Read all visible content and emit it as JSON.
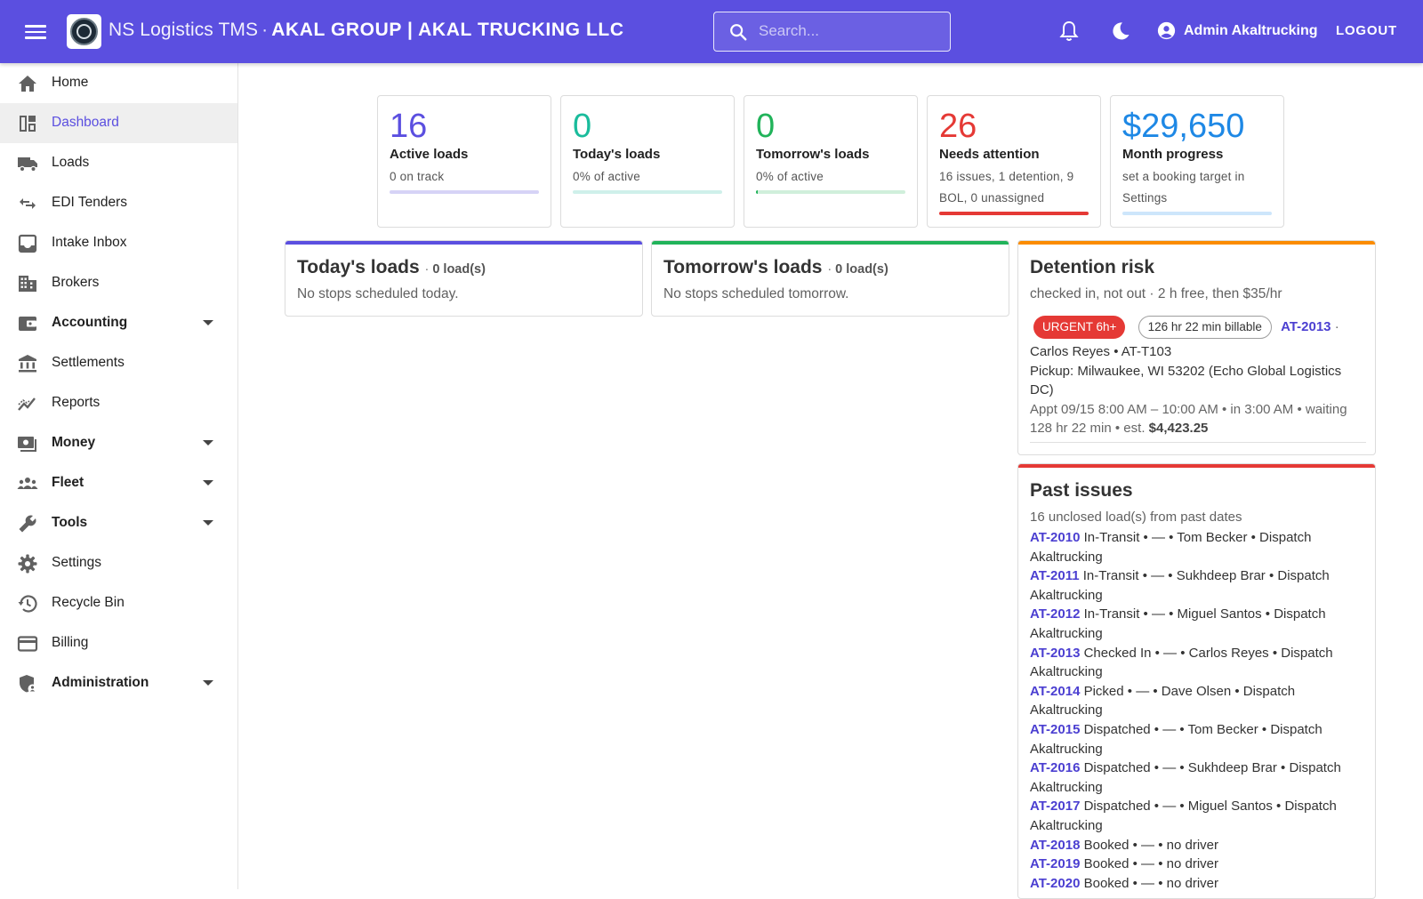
{
  "header": {
    "app_name": "NS Logistics TMS",
    "separator": "·",
    "company": "AKAL GROUP | AKAL TRUCKING LLC",
    "search_placeholder": "Search...",
    "user_name": "Admin Akaltrucking",
    "logout_label": "LOGOUT",
    "brand_color": "#5b4fe0"
  },
  "sidebar": {
    "items": [
      {
        "label": "Home",
        "icon": "home-icon"
      },
      {
        "label": "Dashboard",
        "icon": "dashboard-icon",
        "active": true
      },
      {
        "label": "Loads",
        "icon": "truck-icon"
      },
      {
        "label": "EDI Tenders",
        "icon": "swap-arrows-icon"
      },
      {
        "label": "Intake Inbox",
        "icon": "inbox-icon"
      },
      {
        "label": "Brokers",
        "icon": "building-icon"
      },
      {
        "label": "Accounting",
        "icon": "wallet-icon",
        "expandable": true
      },
      {
        "label": "Settlements",
        "icon": "bank-icon"
      },
      {
        "label": "Reports",
        "icon": "chart-line-icon"
      },
      {
        "label": "Money",
        "icon": "cash-icon",
        "expandable": true
      },
      {
        "label": "Fleet",
        "icon": "people-icon",
        "expandable": true
      },
      {
        "label": "Tools",
        "icon": "wrench-icon",
        "expandable": true
      },
      {
        "label": "Settings",
        "icon": "gear-icon"
      },
      {
        "label": "Recycle Bin",
        "icon": "history-icon"
      },
      {
        "label": "Billing",
        "icon": "credit-card-icon"
      },
      {
        "label": "Administration",
        "icon": "shield-person-icon",
        "expandable": true
      }
    ]
  },
  "stats": [
    {
      "value": "16",
      "label": "Active loads",
      "sub": "0 on track",
      "color": "#5b4fe0",
      "bar_color": "#d6d3f6",
      "progress": 0
    },
    {
      "value": "0",
      "label": "Today's loads",
      "sub": "0% of active",
      "color": "#1abc9c",
      "bar_color": "#cff0ea",
      "progress": 0
    },
    {
      "value": "0",
      "label": "Tomorrow's loads",
      "sub": "0% of active",
      "color": "#21b35a",
      "bar_color": "#d0efdb",
      "progress": 0
    },
    {
      "value": "26",
      "label": "Needs attention",
      "sub": "16 issues, 1 detention, 9 BOL, 0 unassigned",
      "color": "#e53935",
      "bar_color": "#e53935",
      "progress": 1
    },
    {
      "value": "$29,650",
      "label": "Month progress",
      "sub": "set a booking target in Settings",
      "color": "#1e88e5",
      "bar_color": "#cde6fb",
      "progress": 0
    }
  ],
  "today_panel": {
    "title": "Today's loads",
    "separator": "·",
    "count": "0 load(s)",
    "empty": "No stops scheduled today.",
    "accent": "#5b4fe0"
  },
  "tomorrow_panel": {
    "title": "Tomorrow's loads",
    "separator": "·",
    "count": "0 load(s)",
    "empty": "No stops scheduled tomorrow.",
    "accent": "#21b35a"
  },
  "detention_panel": {
    "title": "Detention risk",
    "subtitle": "checked in, not out · 2 h free, then $35/hr",
    "accent": "#fb8c00",
    "urgent_chip": "URGENT 6h+",
    "billable_chip": "126 hr 22 min billable",
    "load_id": "AT-2013",
    "load_suffix": "·",
    "driver_line": "Carlos Reyes • AT-T103",
    "pickup_line": "Pickup: Milwaukee, WI 53202 (Echo Global Logistics DC)",
    "appt_line": "Appt 09/15 8:00 AM – 10:00 AM • in 3:00 AM • waiting 128 hr 22 min • est.",
    "estimate": "$4,423.25"
  },
  "past_issues_panel": {
    "title": "Past issues",
    "subtitle": "16 unclosed load(s) from past dates",
    "accent": "#e53935",
    "rows": [
      {
        "id": "AT-2010",
        "text": "In-Transit • — • Tom Becker • Dispatch Akaltrucking"
      },
      {
        "id": "AT-2011",
        "text": "In-Transit • — • Sukhdeep Brar • Dispatch Akaltrucking"
      },
      {
        "id": "AT-2012",
        "text": "In-Transit • — • Miguel Santos • Dispatch Akaltrucking"
      },
      {
        "id": "AT-2013",
        "text": "Checked In • — • Carlos Reyes • Dispatch Akaltrucking"
      },
      {
        "id": "AT-2014",
        "text": "Picked • — • Dave Olsen • Dispatch Akaltrucking"
      },
      {
        "id": "AT-2015",
        "text": "Dispatched • — • Tom Becker • Dispatch Akaltrucking"
      },
      {
        "id": "AT-2016",
        "text": "Dispatched • — • Sukhdeep Brar • Dispatch Akaltrucking"
      },
      {
        "id": "AT-2017",
        "text": "Dispatched • — • Miguel Santos • Dispatch Akaltrucking"
      },
      {
        "id": "AT-2018",
        "text": "Booked • — • no driver"
      },
      {
        "id": "AT-2019",
        "text": "Booked • — • no driver"
      },
      {
        "id": "AT-2020",
        "text": "Booked • — • no driver"
      }
    ]
  }
}
